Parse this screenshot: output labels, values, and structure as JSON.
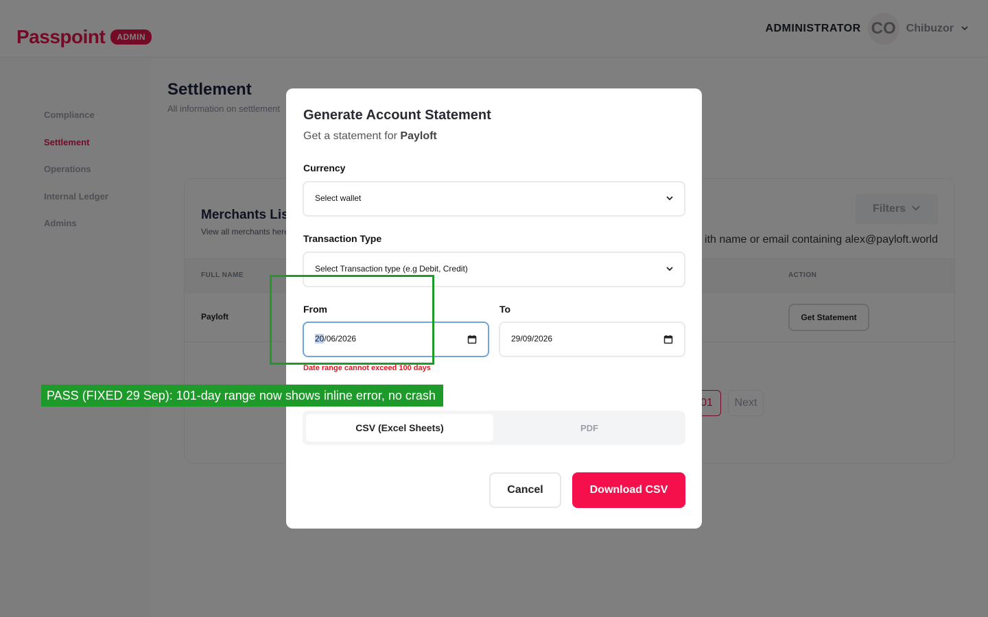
{
  "header": {
    "logo_text": "Passpoint",
    "logo_badge": "ADMIN",
    "role": "ADMINISTRATOR",
    "avatar_initials": "CO",
    "user_name": "Chibuzor"
  },
  "sidebar": {
    "items": [
      {
        "label": "Compliance",
        "active": false
      },
      {
        "label": "Settlement",
        "active": true
      },
      {
        "label": "Operations",
        "active": false
      },
      {
        "label": "Internal Ledger",
        "active": false
      },
      {
        "label": "Admins",
        "active": false
      }
    ]
  },
  "main": {
    "title": "Settlement",
    "subtitle": "All information on settlement"
  },
  "merchants": {
    "title": "Merchants List",
    "subtitle": "View all merchants here",
    "filters_label": "Filters",
    "search_hint": "ith name or email containing alex@payloft.world",
    "columns": {
      "full_name": "FULL NAME",
      "action": "ACTION"
    },
    "rows": [
      {
        "full_name": "Payloft",
        "action_label": "Get Statement"
      }
    ],
    "pagination": {
      "current": "01",
      "next_label": "Next"
    }
  },
  "modal": {
    "title": "Generate Account Statement",
    "subtitle_prefix": "Get a statement for ",
    "merchant": "Payloft",
    "currency_label": "Currency",
    "currency_value": "Select wallet",
    "type_label": "Transaction Type",
    "type_value": "Select Transaction type (e.g Debit, Credit)",
    "from_label": "From",
    "from_day": "20",
    "from_rest": "/06/2026",
    "to_label": "To",
    "to_value": "29/09/2026",
    "error_text": "Date range cannot exceed 100 days",
    "formats": {
      "csv": "CSV (Excel Sheets)",
      "pdf": "PDF"
    },
    "cancel_label": "Cancel",
    "download_label": "Download CSV"
  },
  "annotation": {
    "text": "PASS (FIXED 29 Sep): 101-day range now shows inline error, no crash",
    "color": "#1e9a2a"
  },
  "colors": {
    "brand": "#e8164c",
    "primary_button": "#f5104b",
    "error": "#e0161f",
    "focus": "#6fa4dc"
  }
}
